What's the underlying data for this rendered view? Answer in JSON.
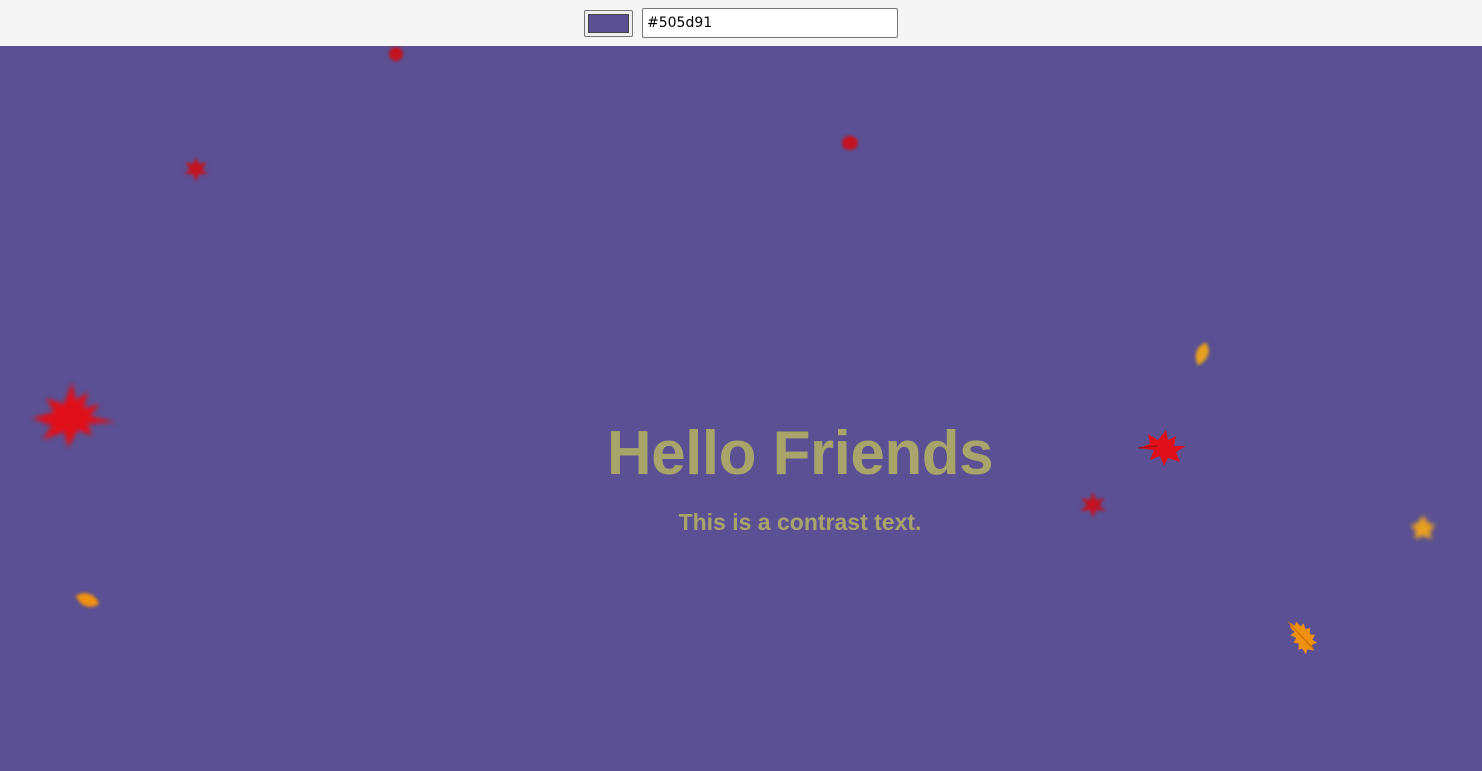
{
  "toolbar": {
    "swatch_color": "#5a5093",
    "hex_value": "#505d91"
  },
  "page": {
    "background": "#5a5093"
  },
  "hero": {
    "title": "Hello Friends",
    "subtitle": "This is a contrast text.",
    "text_color": "#a8a56a"
  },
  "leaves": {
    "red": "#e0101a",
    "deep_red": "#c4121e",
    "orange": "#f0900f",
    "gold": "#e8a020"
  }
}
